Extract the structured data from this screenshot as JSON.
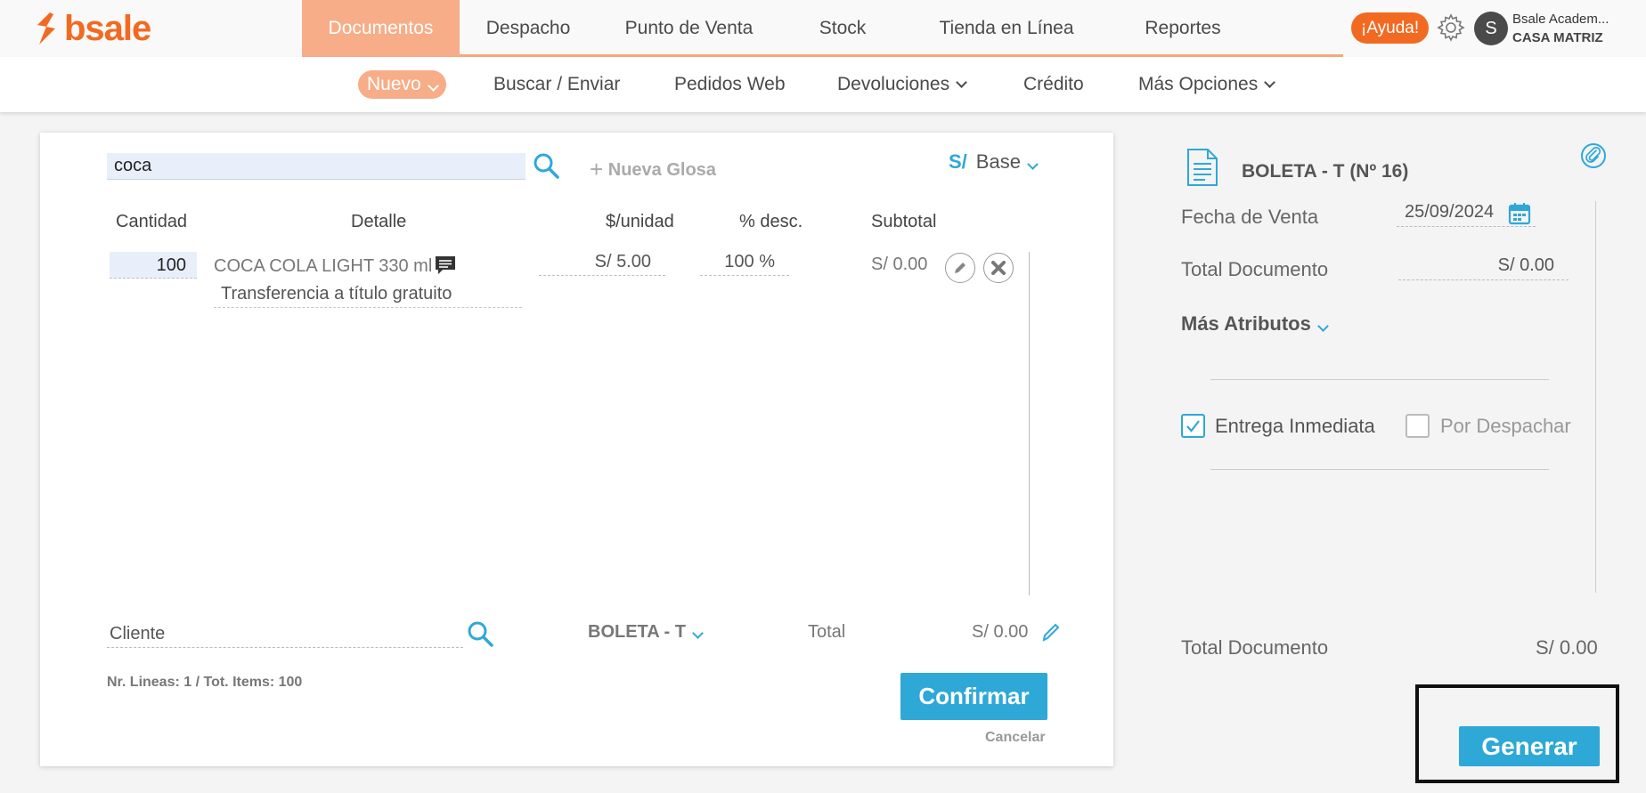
{
  "brand": {
    "logo_text": "bsale",
    "accent": "#f26a21",
    "primary": "#2ea8d6"
  },
  "nav": {
    "items": [
      "Documentos",
      "Despacho",
      "Punto de Venta",
      "Stock",
      "Tienda en Línea",
      "Reportes"
    ],
    "active": "Documentos"
  },
  "header": {
    "help_label": "¡Ayuda!",
    "avatar_initial": "S",
    "user_name": "Bsale Academ...",
    "user_branch": "CASA MATRIZ"
  },
  "subnav": {
    "nuevo": "Nuevo",
    "buscar": "Buscar / Enviar",
    "pedidos": "Pedidos Web",
    "devoluciones": "Devoluciones",
    "credito": "Crédito",
    "mas": "Más Opciones"
  },
  "editor": {
    "search_value": "coca",
    "nueva_glosa": "Nueva Glosa",
    "currency_symbol": "S/",
    "price_list": "Base",
    "columns": {
      "cantidad": "Cantidad",
      "detalle": "Detalle",
      "unidad": "$/unidad",
      "desc": "% desc.",
      "subtotal": "Subtotal"
    },
    "line": {
      "qty": "100",
      "name": "COCA COLA LIGHT 330 ml",
      "note": "Transferencia a título gratuito",
      "price": "S/ 5.00",
      "discount": "100 %",
      "subtotal": "S/ 0.00"
    },
    "client_placeholder": "Cliente",
    "doc_type": "BOLETA - T",
    "total_label": "Total",
    "total_value": "S/ 0.00",
    "lines_info": "Nr. Lineas: 1 / Tot. Items: 100",
    "confirm": "Confirmar",
    "cancel": "Cancelar"
  },
  "panel": {
    "doc_title": "BOLETA - T (Nº 16)",
    "fecha_label": "Fecha de Venta",
    "fecha_value": "25/09/2024",
    "total_doc_label": "Total Documento",
    "total_doc_value": "S/ 0.00",
    "mas_atributos": "Más Atributos",
    "entrega": "Entrega Inmediata",
    "entrega_checked": true,
    "despachar": "Por Despachar",
    "despachar_checked": false,
    "footer_total_label": "Total Documento",
    "footer_total_value": "S/ 0.00",
    "generar": "Generar"
  }
}
